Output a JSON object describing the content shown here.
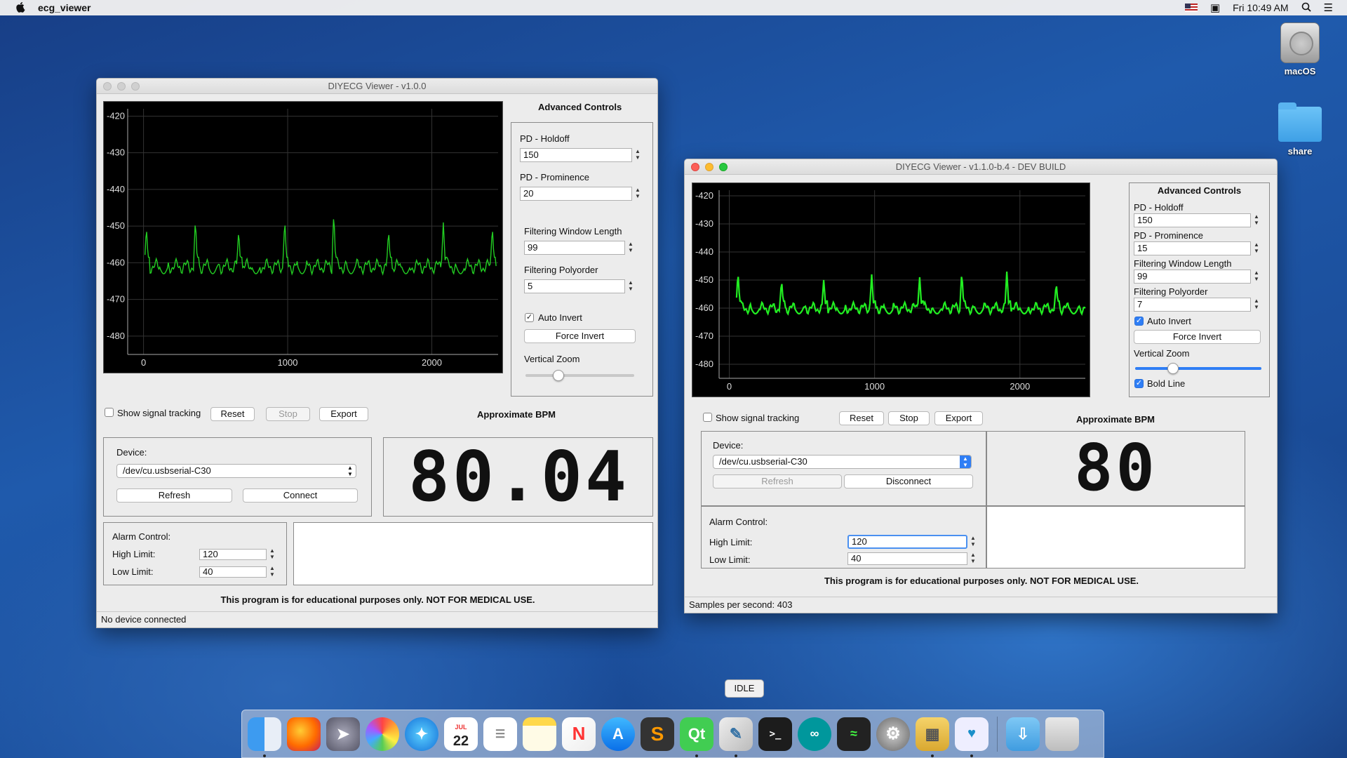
{
  "menubar": {
    "app": "ecg_viewer",
    "clock": "Fri 10:49 AM"
  },
  "desktop": {
    "disk_label": "macOS",
    "folder_label": "share"
  },
  "win1": {
    "title": "DIYECG Viewer - v1.0.0",
    "chart_data": {
      "type": "line",
      "ylim": [
        -485,
        -418
      ],
      "xlim": [
        -110,
        2460
      ],
      "yticks": [
        "-420",
        "-430",
        "-440",
        "-450",
        "-460",
        "-470",
        "-480"
      ],
      "xticks": [
        "0",
        "1000",
        "2000"
      ],
      "line_color": "#22cc22",
      "peaks_x": [
        20,
        360,
        660,
        980,
        1320,
        1700,
        2080,
        2420
      ],
      "baseline": -461,
      "peak_values": [
        -450,
        -448,
        -451,
        -448,
        -446,
        -451,
        -449,
        -450
      ],
      "x_end": 2450
    },
    "adv_title": "Advanced Controls",
    "holdoff_label": "PD - Holdoff",
    "holdoff": "150",
    "prominence_label": "PD - Prominence",
    "prominence": "20",
    "fwl_label": "Filtering Window Length",
    "fwl": "99",
    "poly_label": "Filtering Polyorder",
    "poly": "5",
    "auto_invert": "Auto Invert",
    "force_invert": "Force Invert",
    "vzoom": "Vertical Zoom",
    "zoom_level": 0.3,
    "show_tracking": "Show signal tracking",
    "reset": "Reset",
    "stop": "Stop",
    "export": "Export",
    "bpm_label": "Approximate BPM",
    "bpm": "80.04",
    "device_label": "Device:",
    "device": "/dev/cu.usbserial-C30",
    "refresh": "Refresh",
    "connect": "Connect",
    "alarm_label": "Alarm Control:",
    "high_label": "High Limit:",
    "high": "120",
    "low_label": "Low Limit:",
    "low": "40",
    "disclaimer": "This program is for educational purposes only. NOT FOR MEDICAL USE.",
    "status": "No device connected"
  },
  "win2": {
    "title": "DIYECG Viewer - v1.1.0-b.4 - DEV BUILD",
    "chart_data": {
      "type": "line",
      "ylim": [
        -485,
        -418
      ],
      "xlim": [
        -70,
        2450
      ],
      "yticks": [
        "-420",
        "-430",
        "-440",
        "-450",
        "-460",
        "-470",
        "-480"
      ],
      "xticks": [
        "0",
        "1000",
        "2000"
      ],
      "line_color": "#22ee22",
      "peaks_x": [
        60,
        360,
        650,
        980,
        1310,
        1600,
        1910,
        2250
      ],
      "baseline": -460,
      "peak_values": [
        -447,
        -450,
        -450,
        -448,
        -449,
        -447,
        -447,
        -451
      ],
      "x_end": 2450
    },
    "adv_title": "Advanced Controls",
    "holdoff_label": "PD - Holdoff",
    "holdoff": "150",
    "prominence_label": "PD - Prominence",
    "prominence": "15",
    "fwl_label": "Filtering Window Length",
    "fwl": "99",
    "poly_label": "Filtering Polyorder",
    "poly": "7",
    "auto_invert": "Auto Invert",
    "force_invert": "Force Invert",
    "vzoom": "Vertical Zoom",
    "zoom_level": 0.3,
    "bold_line": "Bold Line",
    "show_tracking": "Show signal tracking",
    "reset": "Reset",
    "stop": "Stop",
    "export": "Export",
    "bpm_label": "Approximate BPM",
    "bpm": "80",
    "device_label": "Device:",
    "device": "/dev/cu.usbserial-C30",
    "refresh": "Refresh",
    "disconnect": "Disconnect",
    "alarm_label": "Alarm Control:",
    "high_label": "High Limit:",
    "high": "120",
    "low_label": "Low Limit:",
    "low": "40",
    "disclaimer": "This program is for educational purposes only. NOT FOR MEDICAL USE.",
    "status": "Samples per second: 403"
  },
  "dock": {
    "tooltip": "IDLE",
    "calendar_month": "JUL",
    "calendar_day": "22"
  }
}
